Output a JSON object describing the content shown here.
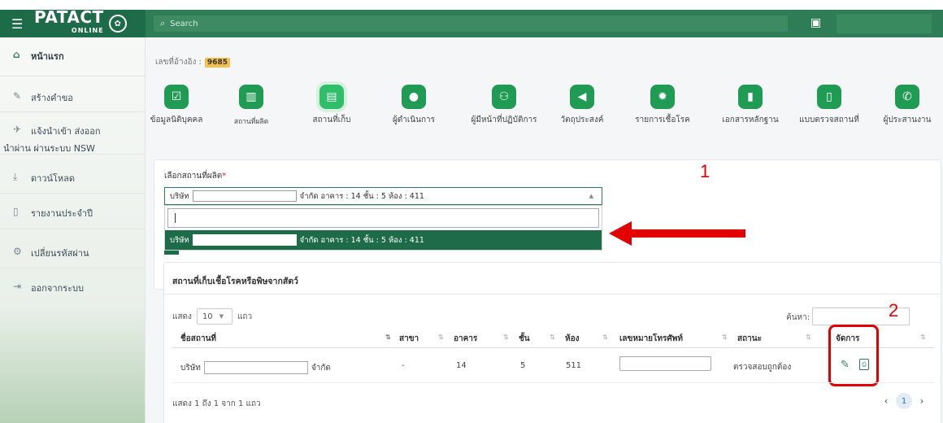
{
  "header": {
    "menu_icon": "hamburger-icon",
    "logo_text": "PATACT",
    "logo_subtext": "ONLINE",
    "search_placeholder": "Search",
    "notification_icon": "clipboard-icon",
    "brand_color": "#1e6b4a"
  },
  "sidebar": {
    "items": [
      {
        "label": "หน้าแรก",
        "icon": "home-icon"
      },
      {
        "label": "สร้างคำขอ",
        "icon": "pencil-icon"
      },
      {
        "label": "แจ้งนำเข้า ส่งออก",
        "label2": "นำผ่าน ผ่านระบบ NSW",
        "icon": "plane-icon"
      },
      {
        "label": "ดาวน์โหลด",
        "icon": "download-icon"
      },
      {
        "label": "รายงานประจำปี",
        "icon": "document-icon"
      },
      {
        "label": "เปลี่ยนรหัสผ่าน",
        "icon": "gears-icon"
      },
      {
        "label": "ออกจากระบบ",
        "icon": "logout-icon"
      }
    ]
  },
  "reference": {
    "label": "เลขที่อ้างอิง :",
    "value": "9685"
  },
  "steps": [
    {
      "label": "ข้อมูลนิติบุคคล",
      "icon": "check-icon"
    },
    {
      "label": "สถานที่ผลิต",
      "icon": "building-icon"
    },
    {
      "label": "สถานที่เก็บ",
      "icon": "archive-icon",
      "current": true
    },
    {
      "label": "ผู้ดำเนินการ",
      "icon": "user-icon"
    },
    {
      "label": "ผู้มีหน้าที่ปฏิบัติการ",
      "icon": "users-icon"
    },
    {
      "label": "วัตถุประสงค์",
      "icon": "megaphone-icon"
    },
    {
      "label": "รายการเชื้อโรค",
      "icon": "germ-icon"
    },
    {
      "label": "เอกสารหลักฐาน",
      "icon": "file-icon"
    },
    {
      "label": "แบบตรวจสถานที่",
      "icon": "clipboard-icon"
    },
    {
      "label": "ผู้ประสานงาน",
      "icon": "phone-book-icon"
    }
  ],
  "production_site": {
    "label": "เลือกสถานที่ผลิต",
    "required_mark": "*",
    "selected_prefix": "บริษัท",
    "selected_suffix": "จำกัด อาคาร : 14 ชั้น : 5 ห้อง : 411",
    "search_value": "",
    "option_prefix": "บริษัท",
    "option_suffix": "จำกัด อาคาร : 14 ชั้น : 5 ห้อง : 411"
  },
  "annotations": {
    "callout_1": "1",
    "callout_2": "2",
    "color": "#e30000"
  },
  "storage_table": {
    "title": "สถานที่เก็บเชื้อโรคหรือพิษจากสัตว์",
    "show_label": "แสดง",
    "entries_value": "10",
    "entries_suffix": "แถว",
    "search_label": "ค้นหา:",
    "search_value": "",
    "columns": [
      "ชื่อสถานที่",
      "สาขา",
      "อาคาร",
      "ชั้น",
      "ห้อง",
      "เลขหมายโทรศัพท์",
      "สถานะ",
      "จัดการ"
    ],
    "rows": [
      {
        "name_prefix": "บริษัท",
        "name_suffix": "จำกัด",
        "branch": "-",
        "building": "14",
        "floor": "5",
        "room": "511",
        "phone": "",
        "status": "ตรวจสอบถูกต้อง",
        "actions": [
          "pencil-icon",
          "print-icon"
        ]
      }
    ],
    "info": "แสดง 1 ถึง 1 จาก 1 แถว",
    "pager": {
      "prev": "‹",
      "current": "1",
      "next": "›"
    }
  }
}
